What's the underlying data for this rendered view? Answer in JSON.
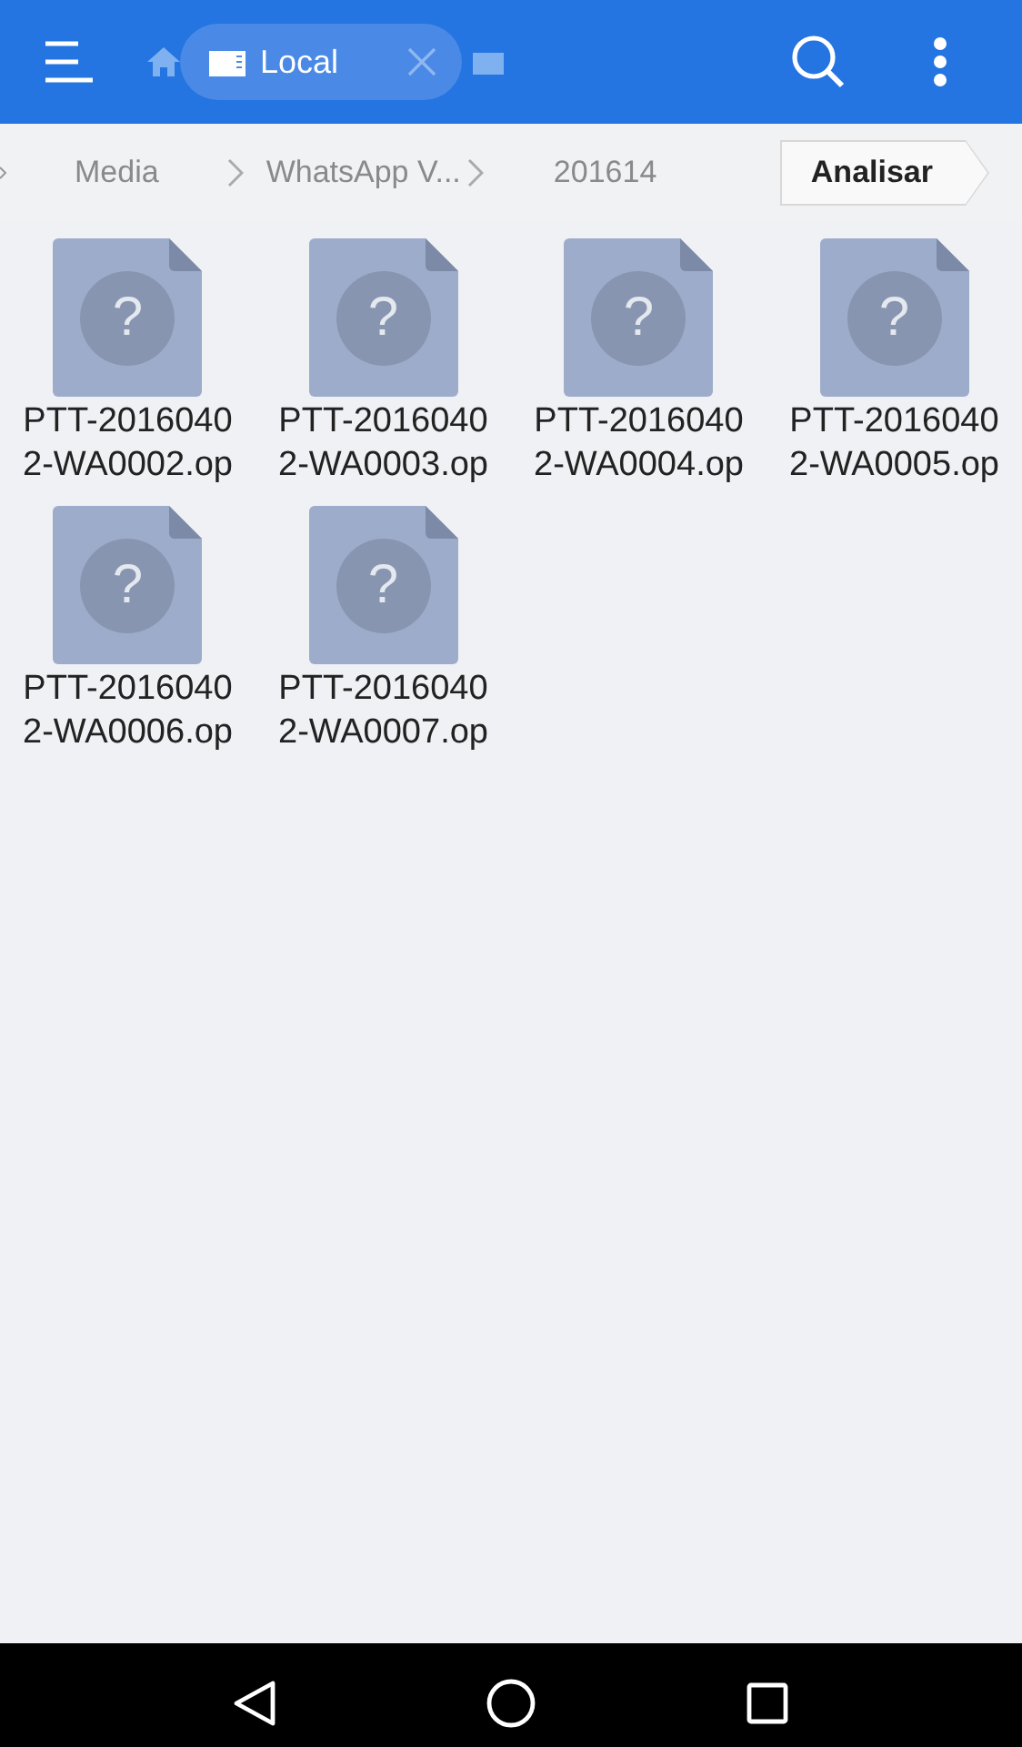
{
  "toolbar": {
    "tabs": [
      {
        "label": "Local",
        "selected": true
      }
    ]
  },
  "breadcrumb": {
    "items": [
      {
        "label": "Media"
      },
      {
        "label": "WhatsApp V..."
      },
      {
        "label": "201614"
      }
    ],
    "action": "Analisar"
  },
  "files": [
    {
      "name": "PTT-20160402-WA0002.op",
      "icon_text": "?"
    },
    {
      "name": "PTT-20160402-WA0003.op",
      "icon_text": "?"
    },
    {
      "name": "PTT-20160402-WA0004.op",
      "icon_text": "?"
    },
    {
      "name": "PTT-20160402-WA0005.op",
      "icon_text": "?"
    },
    {
      "name": "PTT-20160402-WA0006.op",
      "icon_text": "?"
    },
    {
      "name": "PTT-20160402-WA0007.op",
      "icon_text": "?"
    }
  ]
}
